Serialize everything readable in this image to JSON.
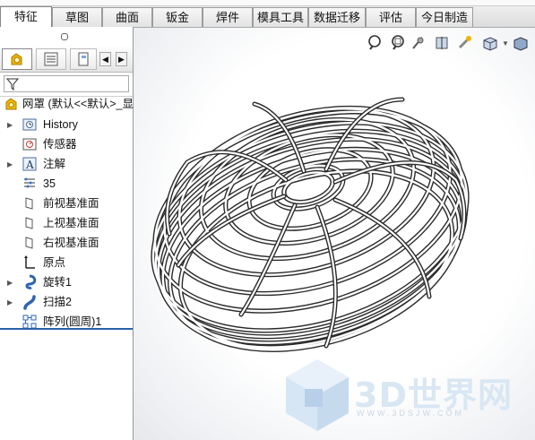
{
  "tabs": [
    {
      "label": "特征",
      "active": true
    },
    {
      "label": "草图"
    },
    {
      "label": "曲面"
    },
    {
      "label": "钣金"
    },
    {
      "label": "焊件"
    },
    {
      "label": "模具工具"
    },
    {
      "label": "数据迁移"
    },
    {
      "label": "评估"
    },
    {
      "label": "今日制造"
    }
  ],
  "tree": {
    "root": "网罩 (默认<<默认>_显",
    "items": [
      {
        "label": "History",
        "icon": "history-folder-icon",
        "expandable": true
      },
      {
        "label": "传感器",
        "icon": "sensor-icon",
        "expandable": false
      },
      {
        "label": "注解",
        "icon": "annotation-icon",
        "expandable": true
      },
      {
        "label": "35",
        "icon": "material-icon",
        "expandable": false
      },
      {
        "label": "前视基准面",
        "icon": "plane-icon",
        "expandable": false
      },
      {
        "label": "上视基准面",
        "icon": "plane-icon",
        "expandable": false
      },
      {
        "label": "右视基准面",
        "icon": "plane-icon",
        "expandable": false
      },
      {
        "label": "原点",
        "icon": "origin-icon",
        "expandable": false
      },
      {
        "label": "旋转1",
        "icon": "revolve-icon",
        "expandable": true
      },
      {
        "label": "扫描2",
        "icon": "sweep-icon",
        "expandable": true
      },
      {
        "label": "阵列(圆周)1",
        "icon": "circular-pattern-icon",
        "expandable": false
      }
    ]
  },
  "watermark": {
    "text": "3D世界网",
    "sub": "WWW.3DSJW.COM"
  },
  "colors": {
    "selection_line": "#2a5fa8",
    "accent_yellow": "#f0b400",
    "watermark": "#d9e7f3"
  }
}
